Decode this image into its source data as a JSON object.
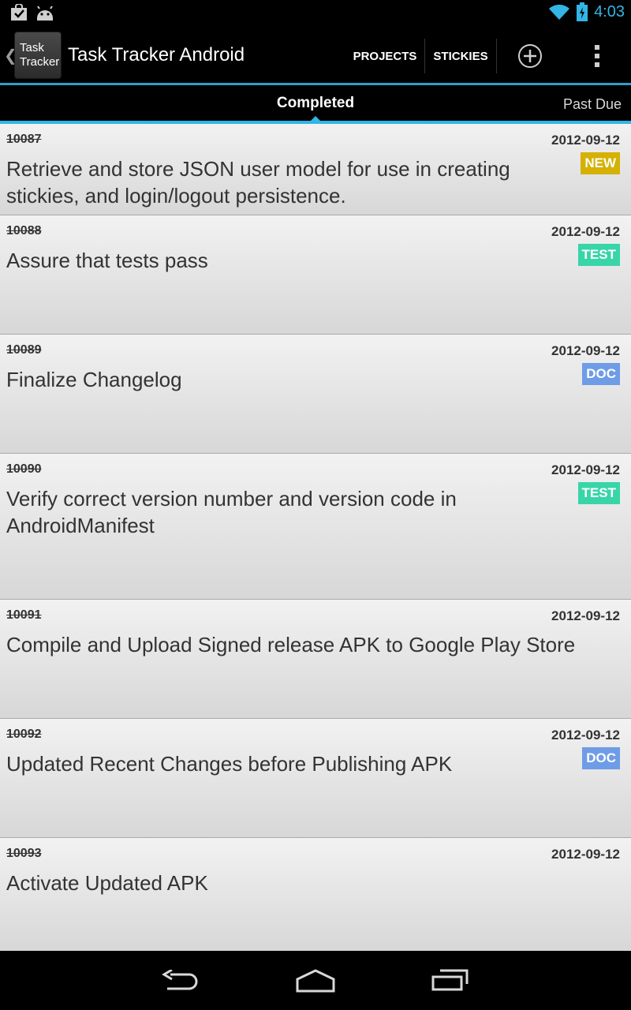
{
  "status_bar": {
    "time": "4:03",
    "left_icons": [
      "shopping-bag-check-icon",
      "android-robot-icon"
    ],
    "right_icons": [
      "wifi-icon",
      "battery-charging-icon"
    ],
    "time_color": "#33b5e5"
  },
  "action_bar": {
    "icon_line1": "Task",
    "icon_line2": "Tracker",
    "title": "Task Tracker Android",
    "buttons": {
      "projects": "PROJECTS",
      "stickies": "STICKIES"
    },
    "icons": [
      "up-caret-icon",
      "add-circle-icon",
      "overflow-menu-icon"
    ],
    "accent_color": "#33b5e5"
  },
  "tabs": {
    "selected": "Completed",
    "next": "Past Due"
  },
  "tasks": [
    {
      "id": "10087",
      "date": "2012-09-12",
      "text": "Retrieve and store JSON user model for use in creating stickies, and login/logout persistence.",
      "badge": "NEW"
    },
    {
      "id": "10088",
      "date": "2012-09-12",
      "text": "Assure that tests pass",
      "badge": "TEST"
    },
    {
      "id": "10089",
      "date": "2012-09-12",
      "text": "Finalize Changelog",
      "badge": "DOC"
    },
    {
      "id": "10090",
      "date": "2012-09-12",
      "text": "Verify correct version number and version code in AndroidManifest",
      "badge": "TEST"
    },
    {
      "id": "10091",
      "date": "2012-09-12",
      "text": "Compile and Upload Signed release APK to Google Play Store",
      "badge": ""
    },
    {
      "id": "10092",
      "date": "2012-09-12",
      "text": "Updated Recent Changes before Publishing APK",
      "badge": "DOC"
    },
    {
      "id": "10093",
      "date": "2012-09-12",
      "text": "Activate Updated APK",
      "badge": ""
    }
  ],
  "badge_colors": {
    "NEW": "#d4b103",
    "TEST": "#38d5a8",
    "DOC": "#6f9ce6"
  },
  "nav_bar": {
    "icons": [
      "back-icon",
      "home-icon",
      "recent-apps-icon"
    ]
  }
}
